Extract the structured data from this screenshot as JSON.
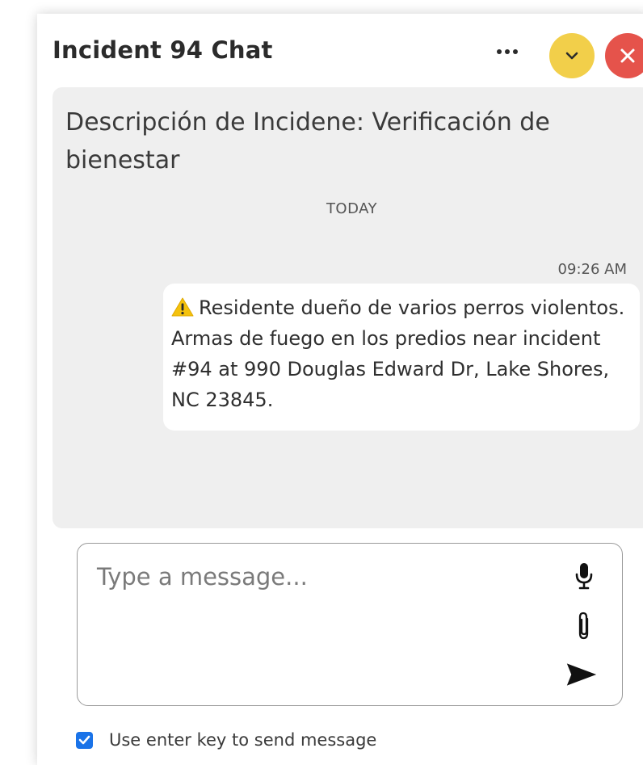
{
  "header": {
    "title": "Incident 94 Chat",
    "more_icon": "ellipsis-icon",
    "minimize_icon": "chevron-down-icon",
    "close_icon": "close-icon"
  },
  "conversation": {
    "description": "Descripción de Incidene: Verificación de bienestar",
    "day_divider": "TODAY",
    "messages": [
      {
        "time": "09:26 AM",
        "icon": "warning-icon",
        "text": "Residente dueño de varios perros violentos. Armas de fuego en los predios near incident #94 at 990 Douglas Edward Dr, Lake Shores, NC 23845."
      }
    ]
  },
  "composer": {
    "placeholder": "Type a message...",
    "value": "",
    "mic_icon": "microphone-icon",
    "attach_icon": "paperclip-icon",
    "send_icon": "send-icon"
  },
  "options": {
    "enter_to_send_label": "Use enter key to send message",
    "enter_to_send_checked": true
  },
  "colors": {
    "minimize_button": "#f2cf4a",
    "close_button": "#e5534b",
    "message_area": "#efefef",
    "checkbox": "#1a73e8",
    "warning": "#f4c20d"
  }
}
